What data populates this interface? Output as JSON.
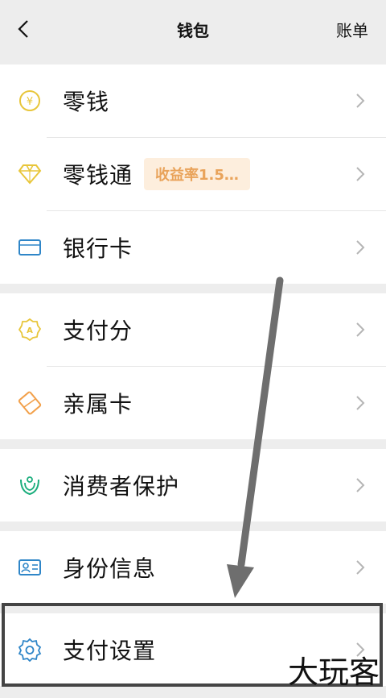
{
  "navbar": {
    "title": "钱包",
    "right_label": "账单"
  },
  "groups": [
    {
      "items": [
        {
          "label": "零钱",
          "icon": "yuan-coin-icon",
          "color": "#e8c63b"
        },
        {
          "label": "零钱通",
          "icon": "diamond-icon",
          "color": "#e8c63b",
          "badge": "收益率1.5…"
        },
        {
          "label": "银行卡",
          "icon": "bank-card-icon",
          "color": "#2f86c8"
        }
      ]
    },
    {
      "items": [
        {
          "label": "支付分",
          "icon": "pay-score-badge-icon",
          "color": "#e8c63b"
        },
        {
          "label": "亲属卡",
          "icon": "family-card-icon",
          "color": "#f2a04a"
        }
      ]
    },
    {
      "items": [
        {
          "label": "消费者保护",
          "icon": "protect-hands-icon",
          "color": "#1aad7c"
        }
      ]
    },
    {
      "items": [
        {
          "label": "身份信息",
          "icon": "id-card-icon",
          "color": "#2f86c8"
        }
      ]
    },
    {
      "items": [
        {
          "label": "支付设置",
          "icon": "gear-icon",
          "color": "#2f86c8"
        }
      ]
    }
  ],
  "watermark": "大玩客"
}
